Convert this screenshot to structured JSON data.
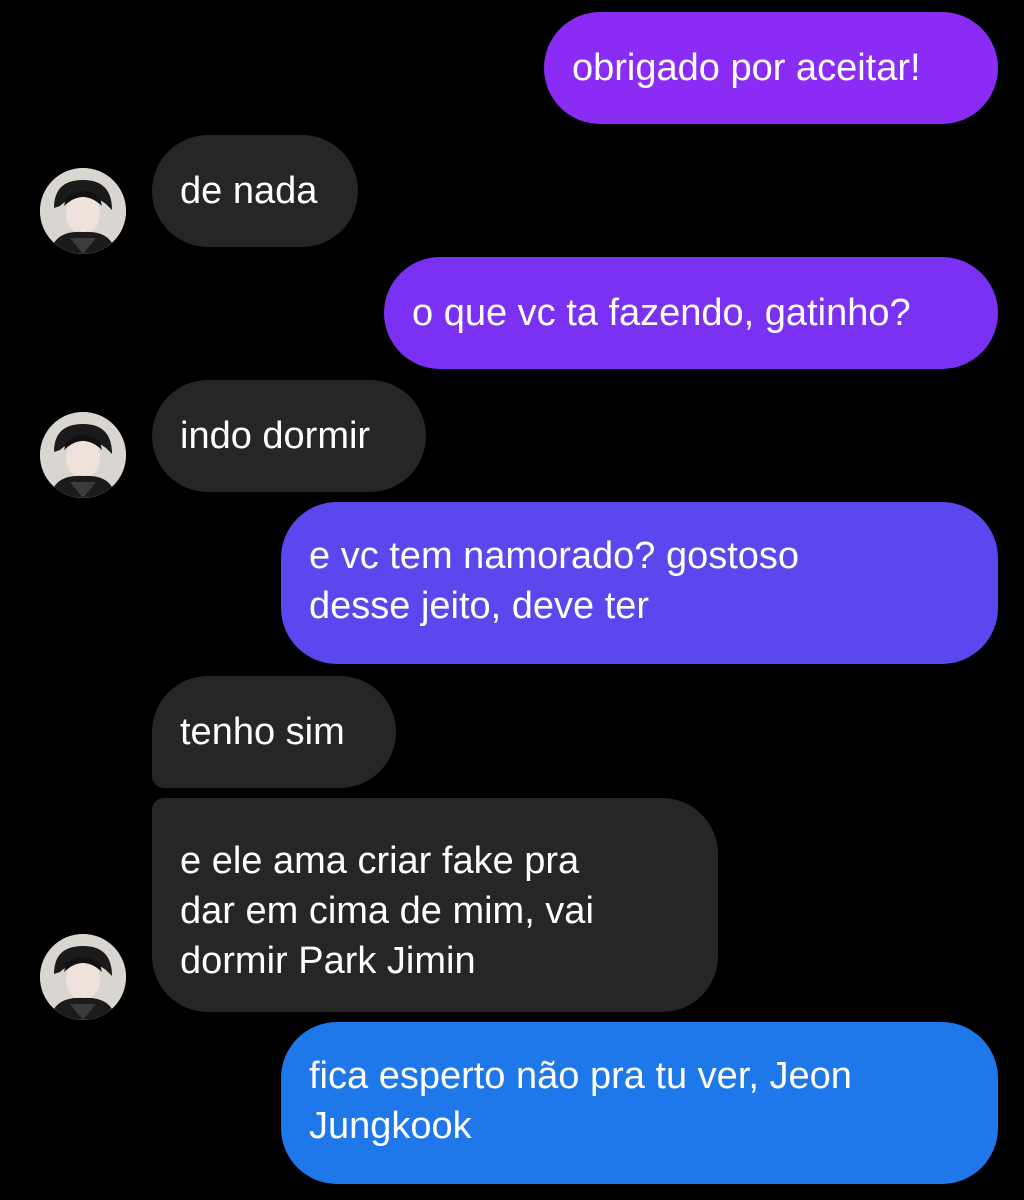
{
  "conversation": {
    "messages": [
      {
        "side": "sent",
        "text": "obrigado por aceitar!"
      },
      {
        "side": "received",
        "text": "de nada"
      },
      {
        "side": "sent",
        "text": "o que vc ta fazendo, gatinho?"
      },
      {
        "side": "received",
        "text": "indo dormir"
      },
      {
        "side": "sent",
        "text": "e vc tem namorado? gostoso\ndesse jeito, deve ter"
      },
      {
        "side": "received",
        "text": "tenho sim"
      },
      {
        "side": "received",
        "text": "e ele ama criar fake pra\ndar em cima de mim, vai\ndormir Park Jimin"
      },
      {
        "side": "sent",
        "text": "fica esperto não pra tu ver, Jeon\nJungkook"
      }
    ]
  },
  "colors": {
    "background": "#000000",
    "received_bubble": "#262626",
    "sent_gradient_top": "#8a2cf5",
    "sent_gradient_bottom": "#1f78ea",
    "text": "#ffffff"
  },
  "icons": {
    "avatar": "profile-photo-icon"
  }
}
